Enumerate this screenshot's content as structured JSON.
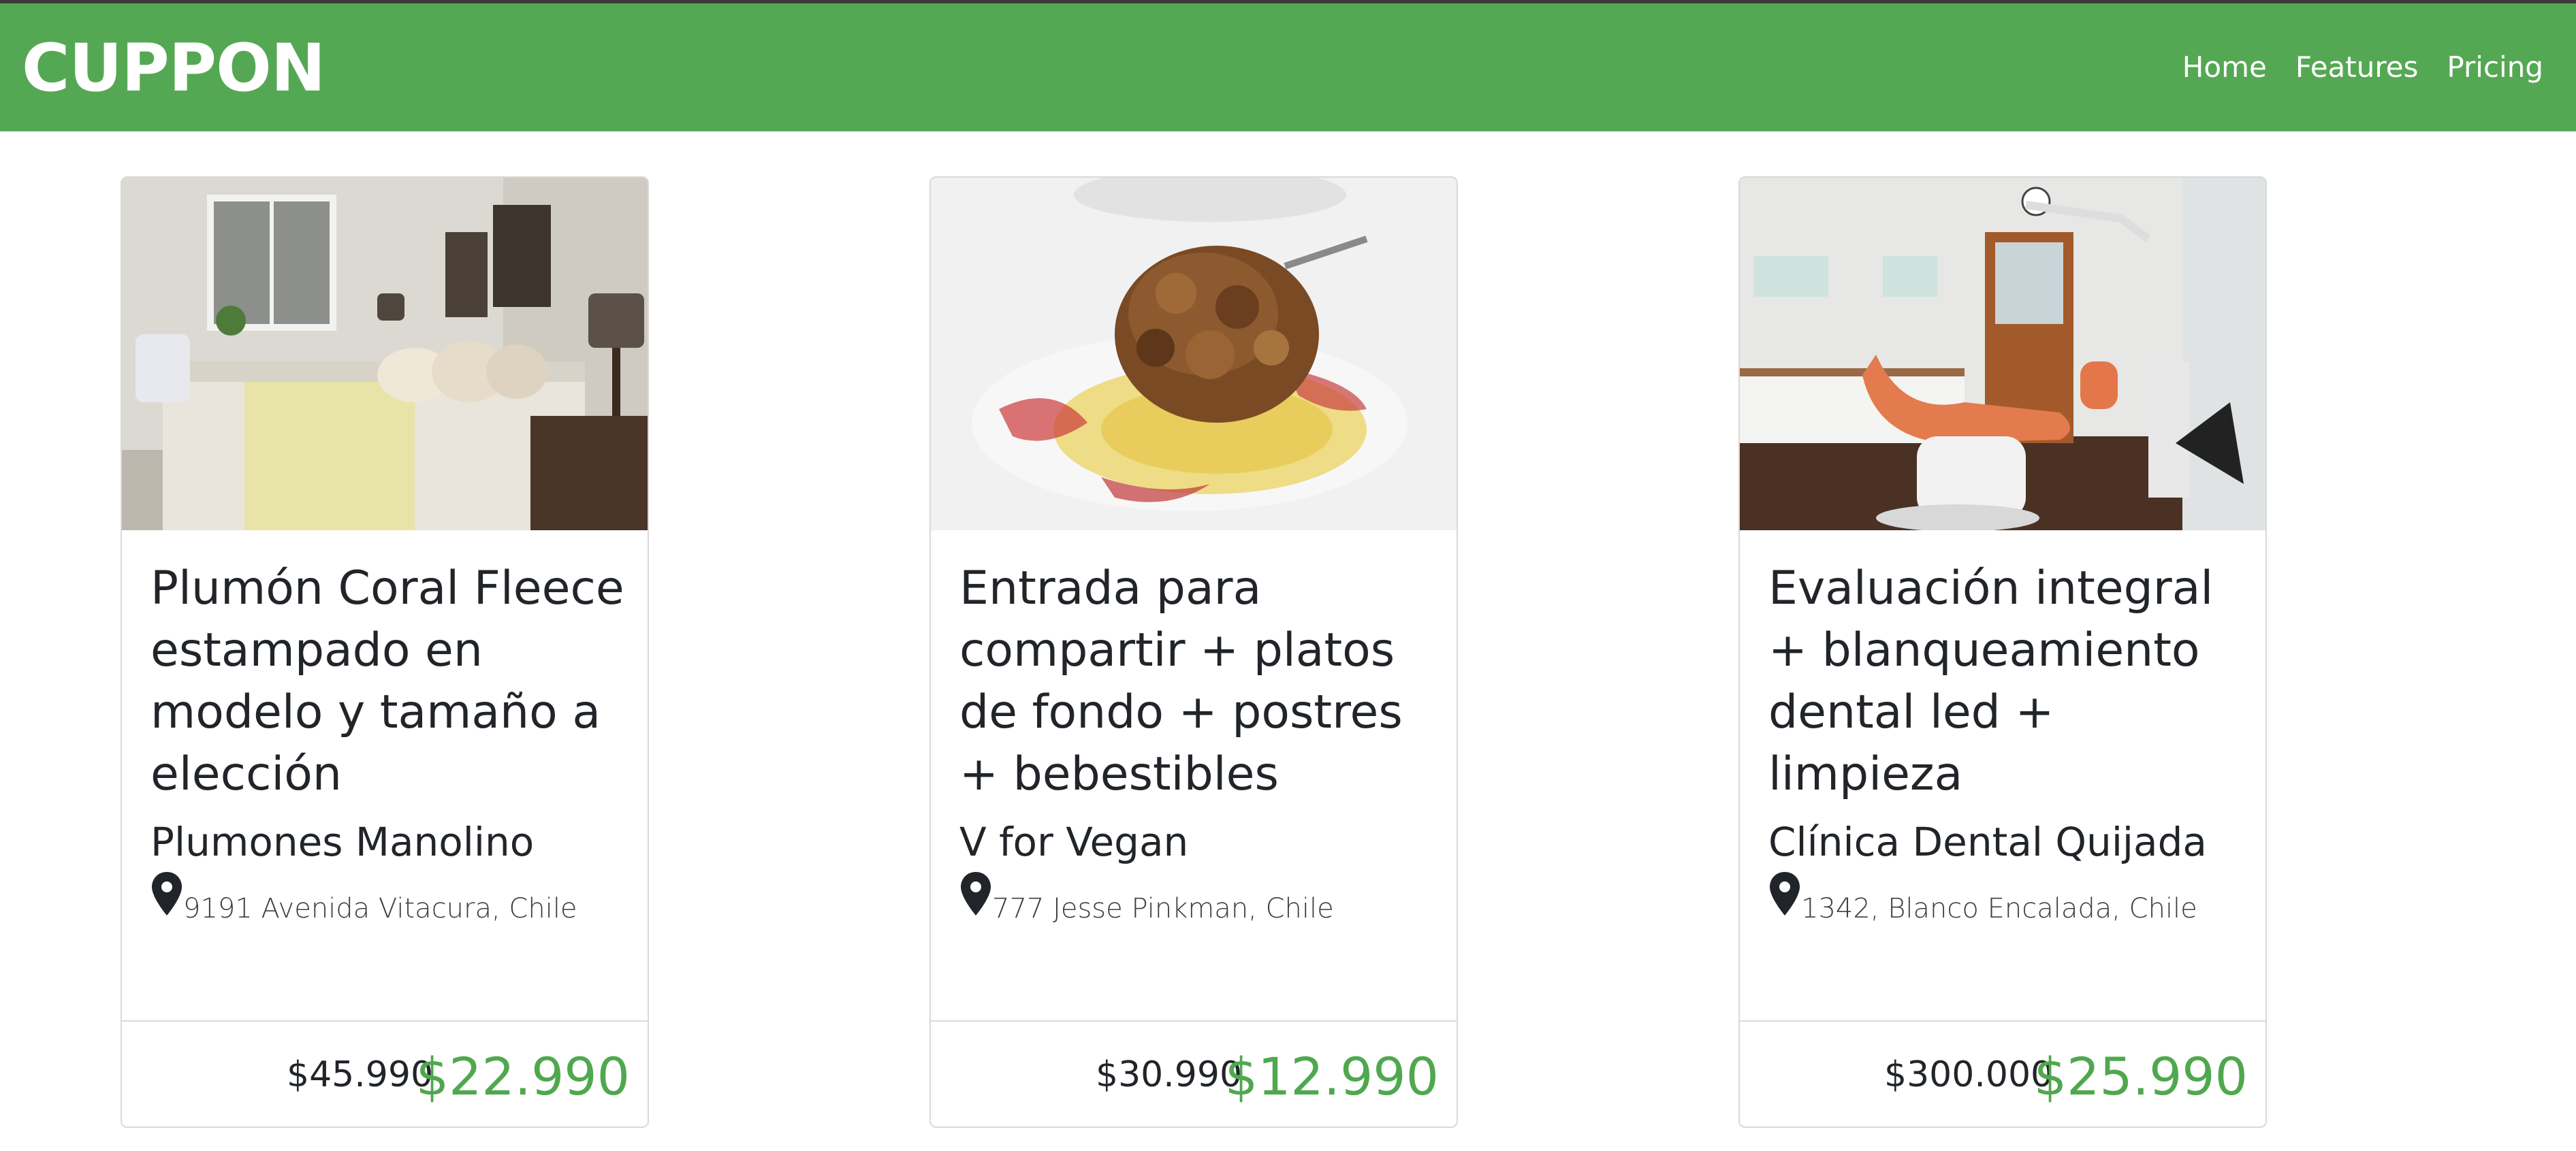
{
  "brand": "CUPPON",
  "nav": [
    {
      "label": "Home"
    },
    {
      "label": "Features"
    },
    {
      "label": "Pricing"
    }
  ],
  "colors": {
    "navbar": "#55a853",
    "price_green": "#4fa84e",
    "text": "#212529"
  },
  "cards": [
    {
      "image": "bedroom",
      "title": "Plumón Coral Fleece estampado en modelo y tamaño a elección",
      "vendor": "Plumones Manolino",
      "address": "9191 Avenida Vitacura, Chile",
      "old_price": "$45.990",
      "new_price": "$22.990"
    },
    {
      "image": "food-plate",
      "title": "Entrada para compartir + platos de fondo + postres + bebestibles",
      "vendor": "V for Vegan",
      "address": "777 Jesse Pinkman, Chile",
      "old_price": "$30.990",
      "new_price": "$12.990"
    },
    {
      "image": "dental-clinic",
      "title": "Evaluación integral + blanqueamiento dental led + limpieza",
      "vendor": "Clínica Dental Quijada",
      "address": "1342, Blanco Encalada, Chile",
      "old_price": "$300.000",
      "new_price": "$25.990"
    }
  ]
}
